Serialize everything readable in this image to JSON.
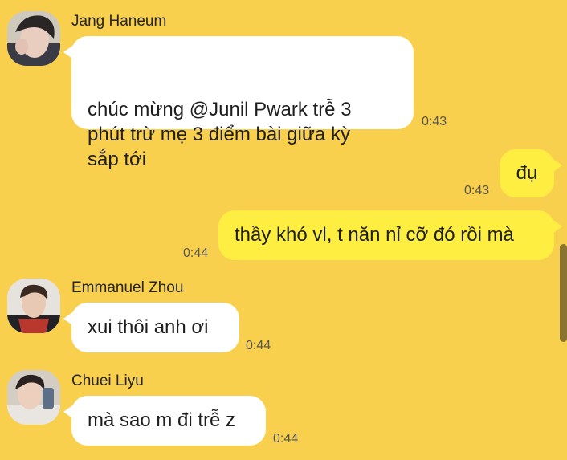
{
  "messages": [
    {
      "sender": "Jang Haneum",
      "text": "chúc mừng @Junil Pwark trễ 3\nphút trừ mẹ 3 điểm bài giữa kỳ\nsắp tới",
      "time": "0:43",
      "direction": "incoming"
    },
    {
      "text": "đụ",
      "time": "0:43",
      "direction": "outgoing"
    },
    {
      "text": "thầy khó vl, t năn nỉ cỡ đó rồi mà",
      "time": "0:44",
      "direction": "outgoing"
    },
    {
      "sender": "Emmanuel Zhou",
      "text": "xui thôi anh ơi",
      "time": "0:44",
      "direction": "incoming"
    },
    {
      "sender": "Chuei Liyu",
      "text": "mà sao m đi trễ z",
      "time": "0:44",
      "direction": "incoming"
    }
  ],
  "theme": {
    "background": "#f9cf4e",
    "incoming_bubble": "#ffffff",
    "outgoing_bubble": "#fdee41"
  }
}
